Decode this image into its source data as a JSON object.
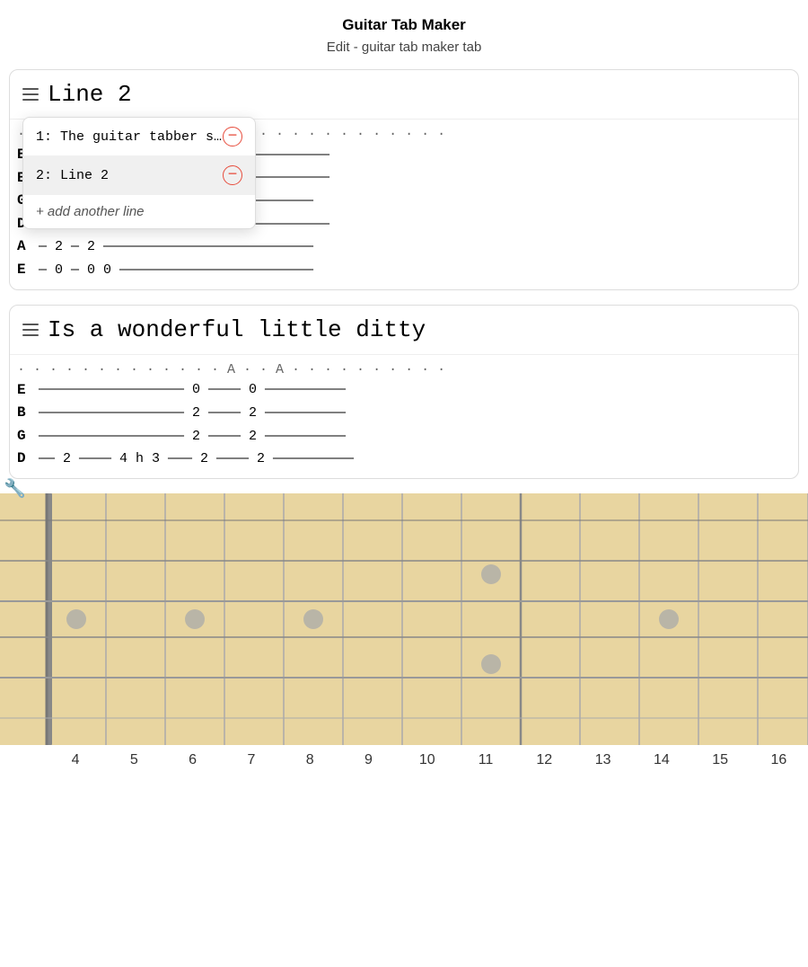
{
  "app": {
    "title": "Guitar Tab Maker",
    "subtitle": "Edit - guitar tab maker tab"
  },
  "sections": [
    {
      "id": "section1",
      "title": "Line 2",
      "dropdown_visible": true,
      "dropdown_items": [
        {
          "id": "item1",
          "label": "1: The guitar tabber s…",
          "active": false
        },
        {
          "id": "item2",
          "label": "2: Line 2",
          "active": true
        }
      ],
      "add_line_label": "+ add another line",
      "dots_row": "· · · · · · · · · · · · · · · · · · · · · · · · · · ·",
      "strings": [
        {
          "label": "E",
          "tab": "——————— 0  0 ————————————————————————"
        },
        {
          "label": "B",
          "tab": "——————— 0  0 ————————————————————————"
        },
        {
          "label": "G",
          "tab": "——————————————  2 h 4 — 2 —————————"
        },
        {
          "label": "D",
          "tab": "— 2 — 2 — 2 h 4 ————————————————————"
        },
        {
          "label": "A",
          "tab": "— 2 — 2 ——————————————————————————"
        },
        {
          "label": "E",
          "tab": "— 0 — 0 0 ————————————————————————"
        }
      ]
    },
    {
      "id": "section2",
      "title": "Is a wonderful little ditty",
      "dropdown_visible": false,
      "dots_row": "· · · · · · · · · · · · · A · · A · · · · · · · · · ·",
      "strings": [
        {
          "label": "E",
          "tab": "—————————————————— 0 ———— 0 ——————————"
        },
        {
          "label": "B",
          "tab": "—————————————————— 2 ———— 2 ——————————"
        },
        {
          "label": "G",
          "tab": "—————————————————— 2 ———— 2 ——————————"
        },
        {
          "label": "D",
          "tab": "—— 2 ———— 4 h 3 ——— 2 ———— 2 ——————————"
        }
      ]
    }
  ],
  "fretboard": {
    "fret_numbers": [
      "4",
      "5",
      "6",
      "7",
      "8",
      "9",
      "10",
      "11",
      "12",
      "13",
      "14",
      "15",
      "16"
    ],
    "dots": [
      {
        "fret": 5,
        "string": 3
      },
      {
        "fret": 7,
        "string": 3
      },
      {
        "fret": 9,
        "string": 3
      },
      {
        "fret": 12,
        "string": 1
      },
      {
        "fret": 12,
        "string": 5
      },
      {
        "fret": 15,
        "string": 3
      }
    ]
  },
  "icons": {
    "hamburger": "≡",
    "remove": "−",
    "wrench": "🔧"
  }
}
